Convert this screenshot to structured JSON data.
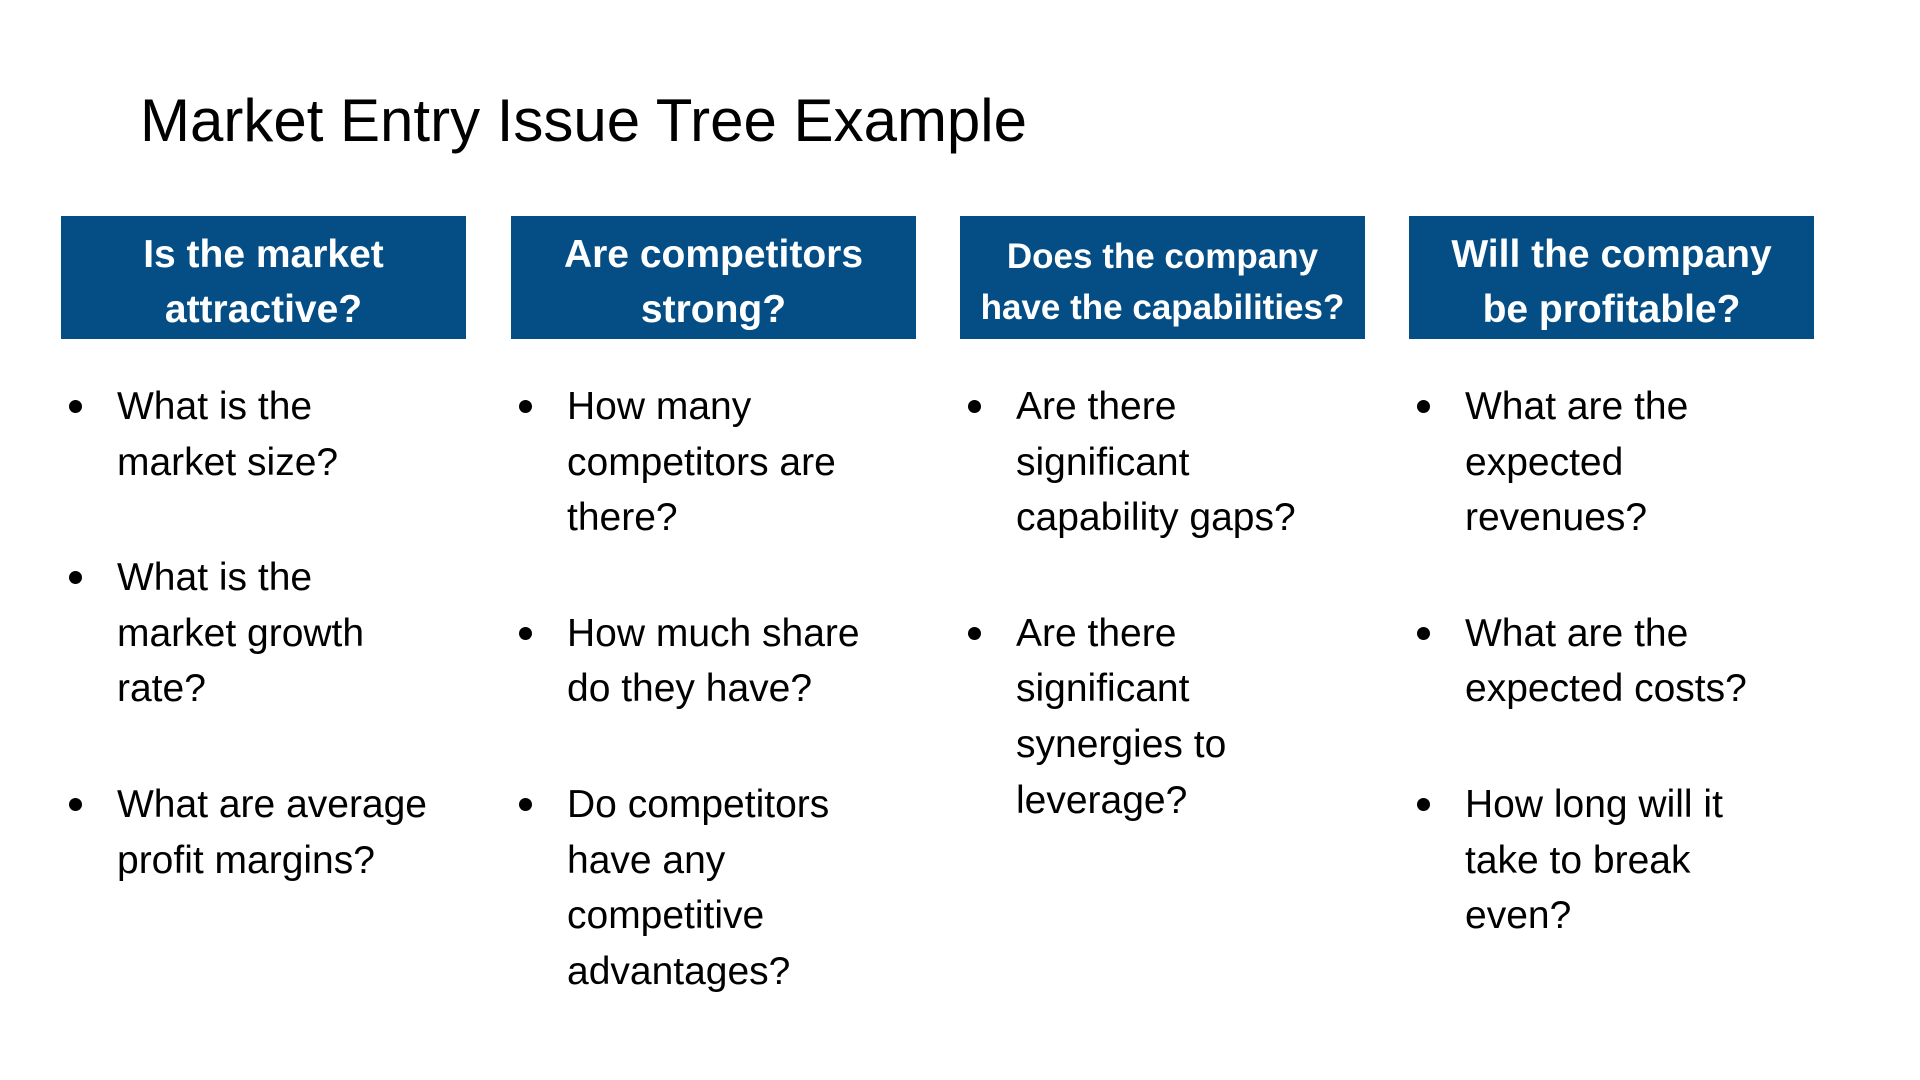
{
  "title": "Market Entry Issue Tree Example",
  "colors": {
    "header_box": "#044E85",
    "header_text": "#FFFFFF",
    "body_text": "#000000"
  },
  "columns": [
    {
      "header": [
        "Is the market",
        "attractive?"
      ],
      "bullets": [
        [
          "What is the",
          "market size?"
        ],
        [
          "What is the",
          "market growth",
          "rate?"
        ],
        [
          "What are average",
          "profit margins?"
        ]
      ]
    },
    {
      "header": [
        "Are competitors",
        "strong?"
      ],
      "bullets": [
        [
          "How many",
          "competitors are",
          "there?"
        ],
        [
          "How much share",
          "do they have?"
        ],
        [
          "Do competitors",
          "have any",
          "competitive",
          "advantages?"
        ]
      ]
    },
    {
      "header": [
        "Does the company",
        "have the capabilities?"
      ],
      "bullets": [
        [
          "Are there",
          "significant",
          "capability gaps?"
        ],
        [
          "Are there",
          "significant",
          "synergies to",
          "leverage?"
        ]
      ]
    },
    {
      "header": [
        "Will the company",
        "be profitable?"
      ],
      "bullets": [
        [
          "What are the",
          "expected",
          "revenues?"
        ],
        [
          "What are the",
          "expected costs?"
        ],
        [
          "How long will it",
          "take to break",
          "even?"
        ]
      ]
    }
  ]
}
